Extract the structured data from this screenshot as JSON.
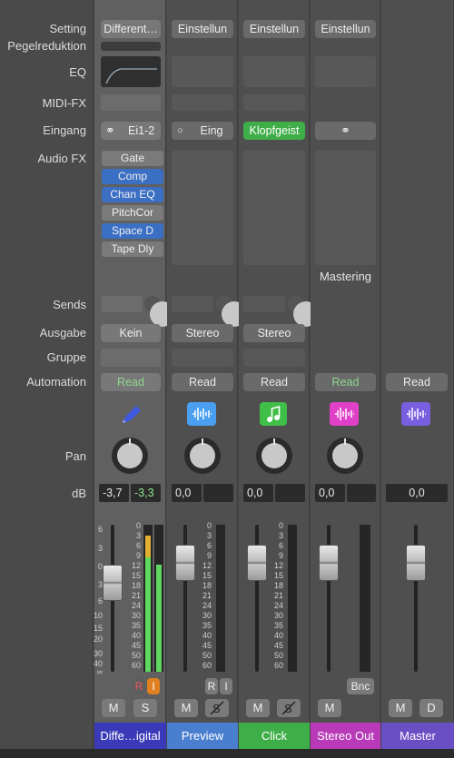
{
  "row_labels": {
    "setting": "Setting",
    "gain_reduction": "Pegelreduktion",
    "eq": "EQ",
    "midi_fx": "MIDI-FX",
    "input": "Eingang",
    "audio_fx": "Audio FX",
    "sends": "Sends",
    "output": "Ausgabe",
    "group": "Gruppe",
    "automation": "Automation",
    "pan": "Pan",
    "db": "dB"
  },
  "fader_scale_left": [
    "6",
    "3",
    "0",
    "3",
    "6",
    "10",
    "15",
    "20",
    "30",
    "40",
    "∞"
  ],
  "meter_scale": [
    "0",
    "3",
    "6",
    "9",
    "12",
    "15",
    "18",
    "21",
    "24",
    "30",
    "35",
    "40",
    "45",
    "50",
    "60"
  ],
  "strips": {
    "s1": {
      "setting": "Different…",
      "input": "Ei1-2",
      "fx": [
        "Gate",
        "Comp",
        "Chan EQ",
        "PitchCor",
        "Space D",
        "Tape Dly"
      ],
      "output": "Kein",
      "automation": "Read",
      "db_left": "-3,7",
      "db_right": "-3,3",
      "r_label": "R",
      "i_label": "I",
      "mute": "M",
      "solo": "S",
      "name": "Diffe…igital",
      "color": "#3a3ab8",
      "fader_level_db": -3.7
    },
    "s2": {
      "setting": "Einstellun",
      "input": "Eing",
      "output": "Stereo",
      "automation": "Read",
      "db_left": "0,0",
      "r_label": "R",
      "i_label": "I",
      "mute": "M",
      "name": "Preview",
      "color": "#4a7fd0"
    },
    "s3": {
      "setting": "Einstellun",
      "input": "Klopfgeist",
      "output": "Stereo",
      "automation": "Read",
      "db_left": "0,0",
      "mute": "M",
      "name": "Click",
      "color": "#3fae48"
    },
    "s4": {
      "setting": "Einstellun",
      "fx_label": "Mastering",
      "automation": "Read",
      "db_left": "0,0",
      "bnc": "Bnc",
      "mute": "M",
      "name": "Stereo Out",
      "color": "#b83ab8"
    },
    "s5": {
      "automation": "Read",
      "db_left": "0,0",
      "mute": "M",
      "dim": "D",
      "name": "Master",
      "color": "#6a4ec4"
    }
  }
}
